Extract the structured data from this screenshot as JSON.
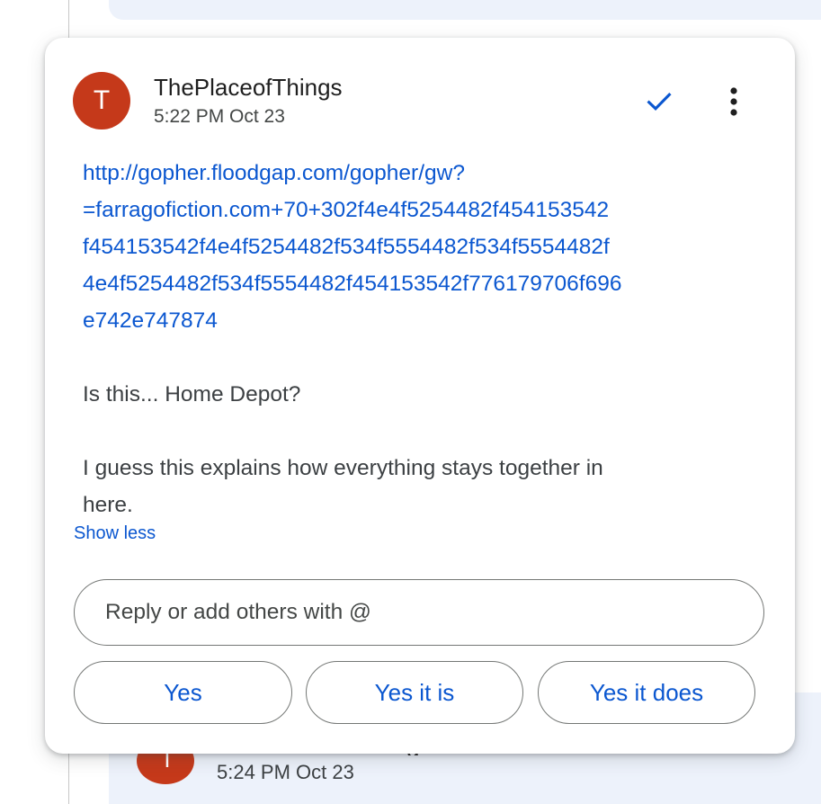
{
  "background": {
    "next_comment": {
      "avatar_letter": "T",
      "timestamp": "5:24 PM Oct 23"
    }
  },
  "comment": {
    "avatar_letter": "T",
    "author": "ThePlaceofThings",
    "timestamp": "5:22 PM Oct 23",
    "link_lines": [
      "http://gopher.floodgap.com/gopher/gw?",
      "=farragofiction.com+70+302f4e4f5254482f454153542",
      "f454153542f4e4f5254482f534f5554482f534f5554482f",
      "4e4f5254482f534f5554482f454153542f776179706f696",
      "e742e747874"
    ],
    "paragraph_1": "Is this... Home Depot?",
    "paragraph_2_lines": [
      "I guess this explains how everything stays together in",
      "here."
    ],
    "show_less_label": "Show less",
    "resolve_icon": "checkmark-icon",
    "more_icon": "more-vert-icon"
  },
  "reply": {
    "placeholder": "Reply or add others with @",
    "value": ""
  },
  "suggestions": [
    {
      "label": "Yes"
    },
    {
      "label": "Yes it is"
    },
    {
      "label": "Yes it does"
    }
  ],
  "colors": {
    "accent": "#0b57d0",
    "avatar": "#c5391a",
    "text": "#3c4043",
    "thread_background": "#edf2fb"
  }
}
